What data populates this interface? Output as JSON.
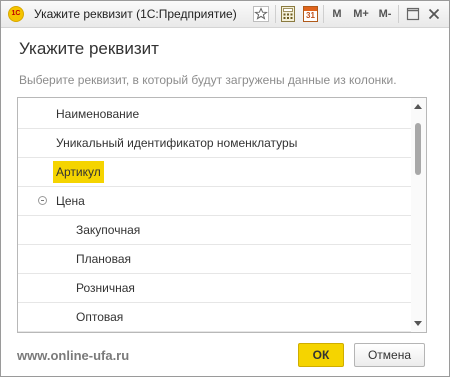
{
  "window": {
    "title": "Укажите реквизит  (1С:Предприятие)",
    "app_icon_text": "1С"
  },
  "toolbar": {
    "m_label": "M",
    "mplus_label": "M+",
    "mminus_label": "M-",
    "calendar_day": "31"
  },
  "dialog": {
    "heading": "Укажите реквизит",
    "hint": "Выберите реквизит, в который будут загружены данные из колонки."
  },
  "list": {
    "items": [
      {
        "label": "Наименование",
        "level": 0,
        "selected": false
      },
      {
        "label": "Уникальный идентификатор номенклатуры",
        "level": 0,
        "selected": false
      },
      {
        "label": "Артикул",
        "level": 0,
        "selected": true
      },
      {
        "label": "Цена",
        "level": 0,
        "selected": false,
        "expanded": true
      },
      {
        "label": "Закупочная",
        "level": 1,
        "selected": false
      },
      {
        "label": "Плановая",
        "level": 1,
        "selected": false
      },
      {
        "label": "Розничная",
        "level": 1,
        "selected": false
      },
      {
        "label": "Оптовая",
        "level": 1,
        "selected": false
      }
    ]
  },
  "buttons": {
    "ok_label": "ОК",
    "cancel_label": "Отмена"
  },
  "watermark": "www.online-ufa.ru",
  "colors": {
    "accent": "#f5d400",
    "hint_text": "#8c8c8c"
  }
}
